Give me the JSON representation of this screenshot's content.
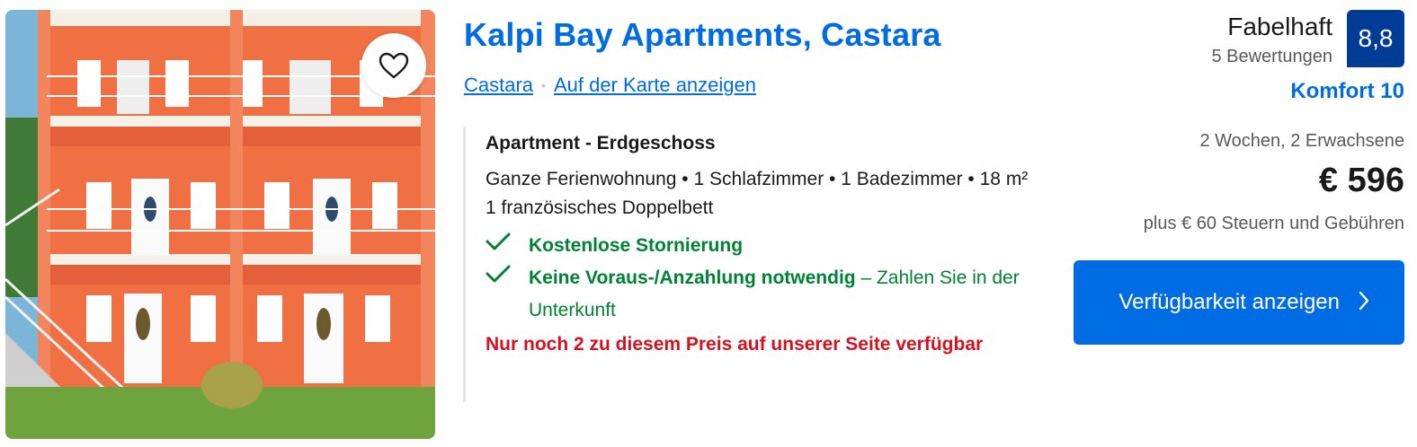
{
  "listing": {
    "title": "Kalpi Bay Apartments, Castara",
    "location_link": "Castara",
    "map_link": "Auf der Karte anzeigen",
    "favorite_icon": "heart-icon"
  },
  "unit": {
    "name": "Apartment - Erdgeschoss",
    "description": "Ganze Ferienwohnung • 1 Schlafzimmer • 1 Badezimmer • 18 m²",
    "bed": "1 französisches Doppelbett",
    "perks": [
      {
        "icon": "check-icon",
        "bold": "Kostenlose Stornierung",
        "rest": ""
      },
      {
        "icon": "check-icon",
        "bold": "Keine Voraus-/Anzahlung notwendig",
        "rest": " – Zahlen Sie in der Unterkunft"
      }
    ],
    "scarcity": "Nur noch 2 zu diesem Preis auf unserer Seite verfügbar"
  },
  "review": {
    "label": "Fabelhaft",
    "count": "5 Bewertungen",
    "score": "8,8",
    "comfort": "Komfort 10"
  },
  "pricing": {
    "stay": "2 Wochen, 2 Erwachsene",
    "price": "€ 596",
    "taxes": "plus € 60 Steuern und Gebühren",
    "cta": "Verfügbarkeit anzeigen",
    "cta_icon": "chevron-right-icon"
  },
  "colors": {
    "link_blue": "#006ce4",
    "score_blue": "#003b95",
    "success_green": "#008234",
    "urgent_red": "#d4111e"
  }
}
